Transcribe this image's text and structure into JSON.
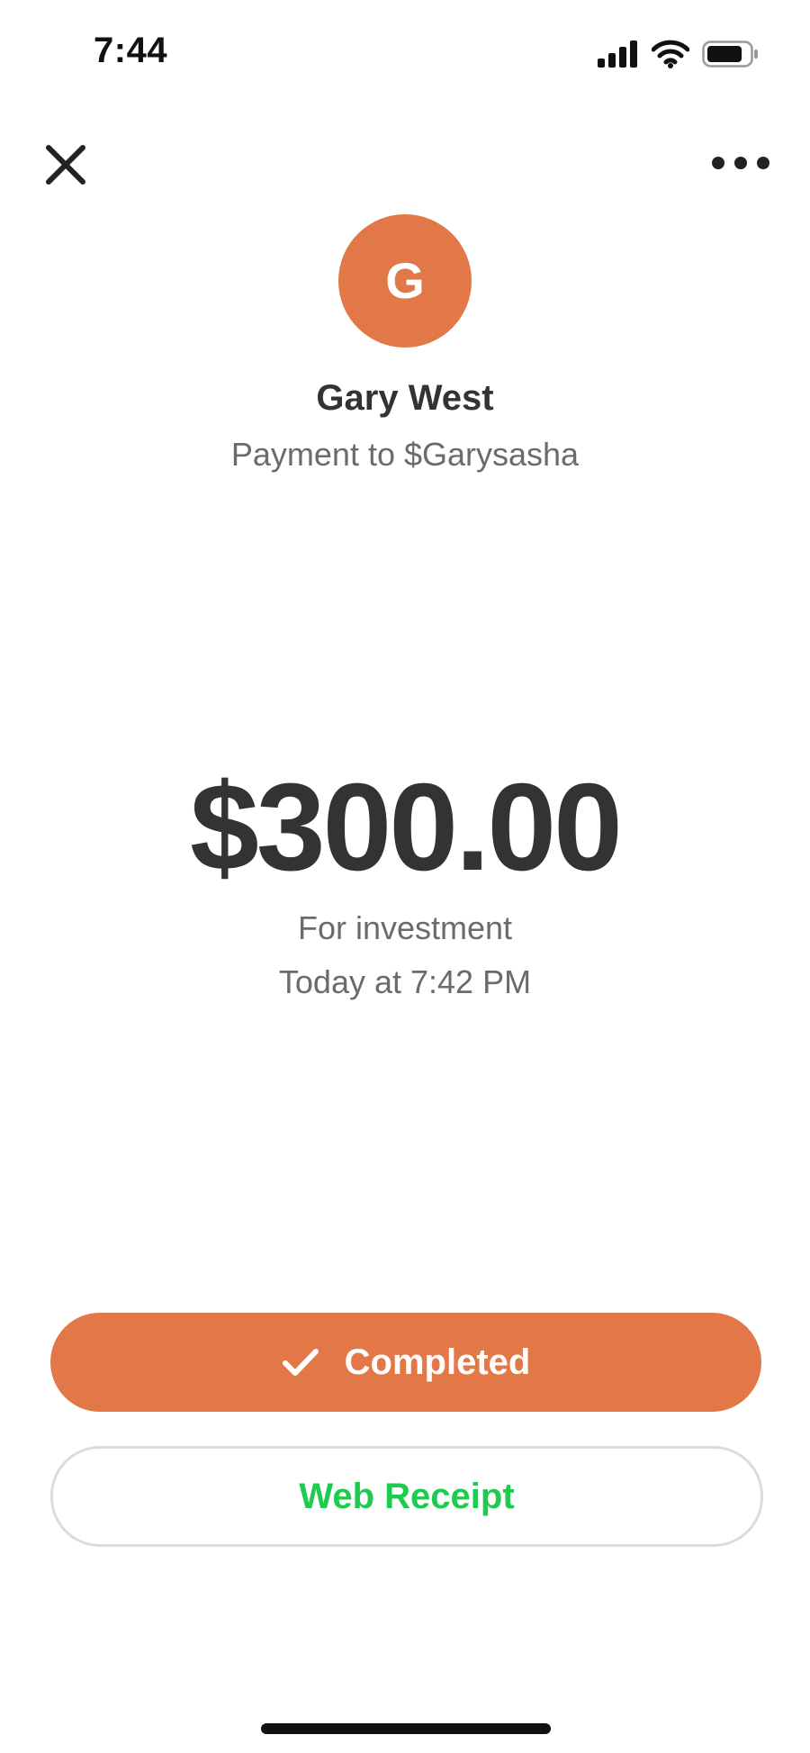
{
  "status_bar": {
    "time": "7:44",
    "icons": [
      "signal-icon",
      "wifi-icon",
      "battery-icon"
    ]
  },
  "nav": {
    "close_icon": "close-icon",
    "more_icon": "more-options-icon"
  },
  "recipient": {
    "initial": "G",
    "name": "Gary West",
    "subtitle": "Payment to $Garysasha",
    "avatar_color": "#E27747"
  },
  "payment": {
    "amount": "$300.00",
    "note": "For investment",
    "timestamp": "Today at 7:42 PM"
  },
  "actions": {
    "status_label": "Completed",
    "status_icon": "checkmark-icon",
    "status_color": "#E27747",
    "receipt_label": "Web Receipt",
    "receipt_color": "#1ECB4F"
  }
}
